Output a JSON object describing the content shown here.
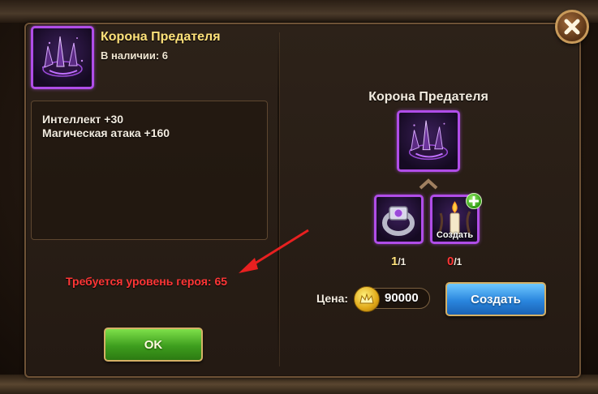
{
  "item": {
    "name": "Корона Предателя",
    "stock_label": "В наличии: 6",
    "stats": [
      "Интеллект +30",
      "Магическая атака +160"
    ],
    "requirement": "Требуется уровень героя: 65",
    "rarity_color": "#b04de8"
  },
  "buttons": {
    "ok_label": "OK",
    "create_label": "Создать",
    "close_icon": "close-x-icon"
  },
  "craft": {
    "title": "Корона Предателя",
    "components": [
      {
        "icon": "ring-icon",
        "have": "1",
        "need": "/1",
        "sufficient": true
      },
      {
        "icon": "candle-icon",
        "have": "0",
        "need": "/1",
        "sufficient": false,
        "overlay_label": "Создать"
      }
    ],
    "price_label": "Цена:",
    "price_value": "90000",
    "currency_icon": "gold-coin-icon"
  },
  "colors": {
    "title_gold": "#ffe27a",
    "warning_red": "#ff3636",
    "ok_green": "#3e9e1e",
    "create_blue": "#2a86de"
  }
}
